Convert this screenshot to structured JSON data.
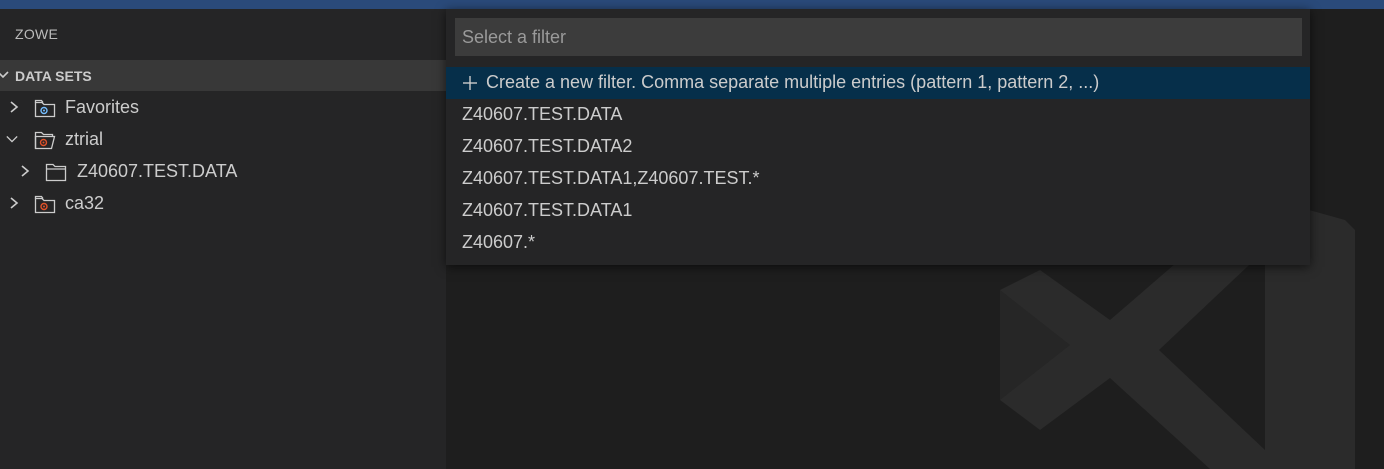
{
  "sidebar": {
    "title": "ZOWE",
    "section": "DATA SETS",
    "tree": [
      {
        "label": "Favorites",
        "icon": "favorites-folder-icon",
        "expanded": false,
        "depth": 0
      },
      {
        "label": "ztrial",
        "icon": "session-folder-icon",
        "expanded": true,
        "depth": 0
      },
      {
        "label": "Z40607.TEST.DATA",
        "icon": "folder-icon",
        "expanded": false,
        "depth": 1
      },
      {
        "label": "ca32",
        "icon": "session-folder-icon",
        "expanded": false,
        "depth": 0
      }
    ]
  },
  "quickpick": {
    "placeholder": "Select a filter",
    "create_label": "Create a new filter. Comma separate multiple entries (pattern 1, pattern 2, ...)",
    "items": [
      "Z40607.TEST.DATA",
      "Z40607.TEST.DATA2",
      "Z40607.TEST.DATA1,Z40607.TEST.*",
      "Z40607.TEST.DATA1",
      "Z40607.*"
    ]
  },
  "colors": {
    "title_bar": "#2a4a7a",
    "sidebar_bg": "#252526",
    "section_header_bg": "#383838",
    "editor_bg": "#1e1e1e",
    "quickpick_bg": "#252526",
    "active_item_bg": "#062f4a",
    "session_icon_accent": "#e0522a"
  }
}
